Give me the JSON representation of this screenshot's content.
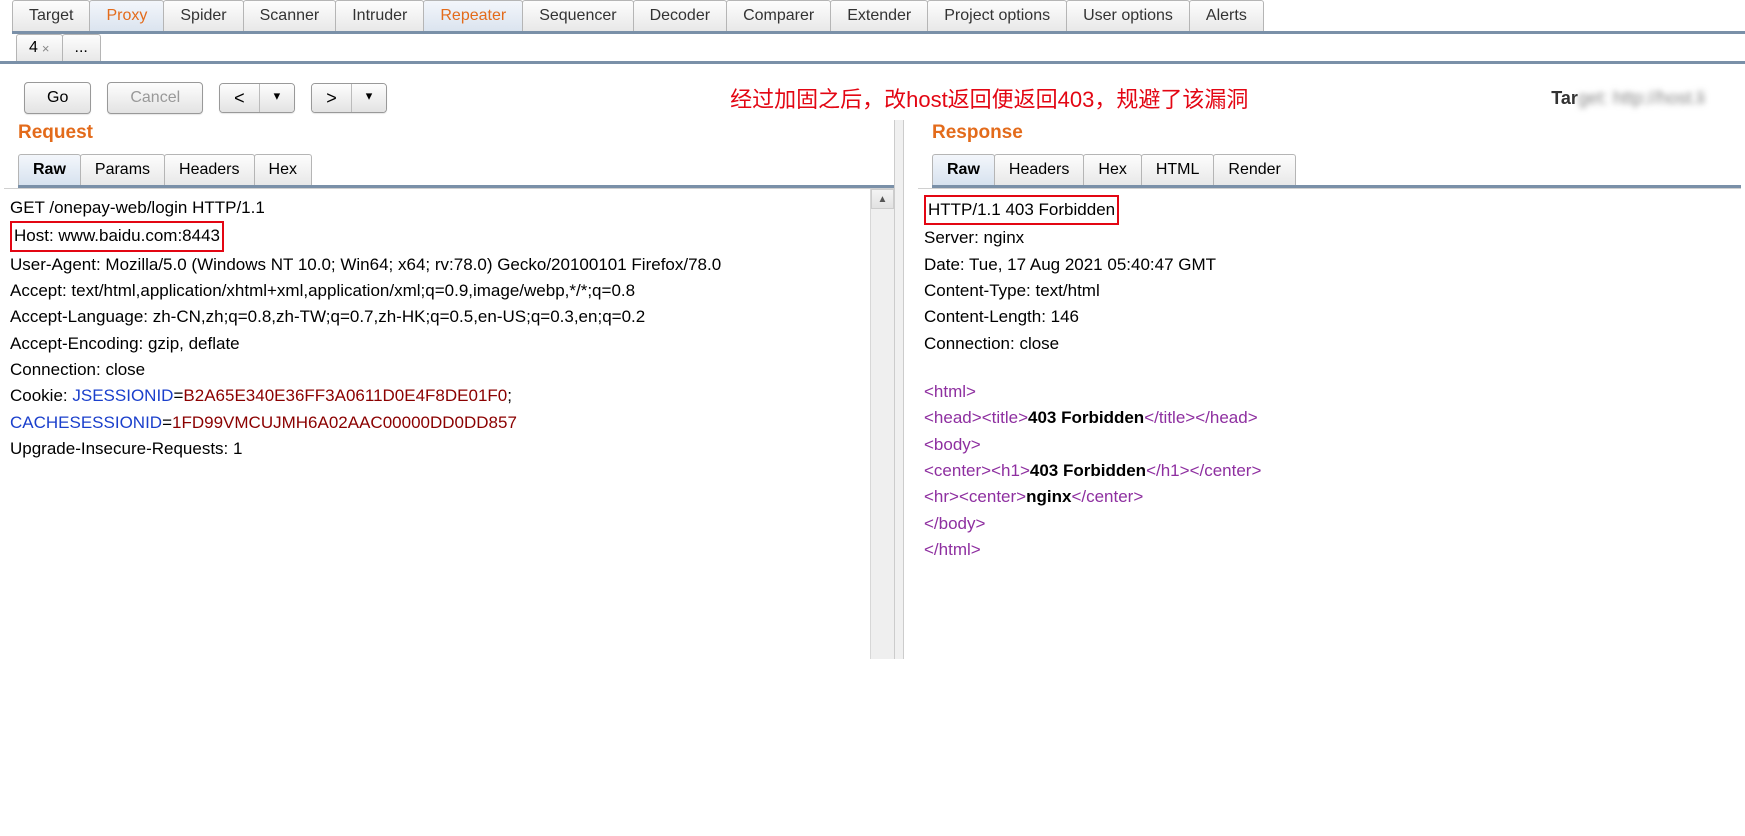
{
  "mainTabs": {
    "t0": "Target",
    "t1": "Proxy",
    "t2": "Spider",
    "t3": "Scanner",
    "t4": "Intruder",
    "t5": "Repeater",
    "t6": "Sequencer",
    "t7": "Decoder",
    "t8": "Comparer",
    "t9": "Extender",
    "t10": "Project options",
    "t11": "User options",
    "t12": "Alerts",
    "active": "Repeater"
  },
  "subTabs": {
    "num": "4",
    "ellipsis": "..."
  },
  "toolbar": {
    "go": "Go",
    "cancel": "Cancel",
    "prev": "<",
    "next": ">",
    "caret": "▾"
  },
  "annotation": "经过加固之后，改host返回便返回403，规避了该漏洞",
  "targetLabel": "Tar",
  "targetBlurred": "get: http://host.li",
  "request": {
    "title": "Request",
    "tabs": {
      "raw": "Raw",
      "params": "Params",
      "headers": "Headers",
      "hex": "Hex"
    },
    "line1": "GET /onepay-web/login HTTP/1.1",
    "hostLine": "Host: www.baidu.com:8443",
    "ua": "User-Agent: Mozilla/5.0 (Windows NT 10.0; Win64; x64; rv:78.0) Gecko/20100101 Firefox/78.0",
    "accept": "Accept: text/html,application/xhtml+xml,application/xml;q=0.9,image/webp,*/*;q=0.8",
    "acceptLang": "Accept-Language: zh-CN,zh;q=0.8,zh-TW;q=0.7,zh-HK;q=0.5,en-US;q=0.3,en;q=0.2",
    "acceptEnc": "Accept-Encoding: gzip, deflate",
    "connection": "Connection: close",
    "cookiePrefix": "Cookie: ",
    "cookieK1": "JSESSIONID",
    "cookieEq": "=",
    "cookieV1": "B2A65E340E36FF3A0611D0E4F8DE01F0",
    "cookieSep": ";",
    "cookieK2": "CACHESESSIONID",
    "cookieV2": "1FD99VMCUJMH6A02AAC00000DD0DD857",
    "upgrade": "Upgrade-Insecure-Requests: 1"
  },
  "response": {
    "title": "Response",
    "tabs": {
      "raw": "Raw",
      "headers": "Headers",
      "hex": "Hex",
      "html": "HTML",
      "render": "Render"
    },
    "status": "HTTP/1.1 403 Forbidden",
    "server": "Server: nginx",
    "date": "Date: Tue, 17 Aug 2021 05:40:47 GMT",
    "ctype": "Content-Type: text/html",
    "clen": "Content-Length: 146",
    "conn": "Connection: close",
    "body": {
      "html_o": "<html>",
      "html_c": "</html>",
      "head_o": "<head>",
      "head_c": "</head>",
      "title_o": "<title>",
      "title_c": "</title>",
      "body_o": "<body>",
      "body_c": "</body>",
      "center_o": "<center>",
      "center_c": "</center>",
      "h1_o": "<h1>",
      "h1_c": "</h1>",
      "hr": "<hr>",
      "forbidden": "403 Forbidden",
      "nginx": "nginx"
    }
  }
}
